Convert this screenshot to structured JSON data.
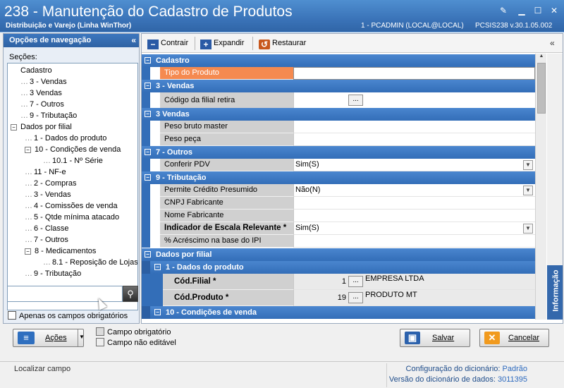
{
  "window": {
    "title": "238 - Manutenção do Cadastro de Produtos",
    "subtitle": "Distribuição e Varejo (Linha WinThor)",
    "session": "1 - PCADMIN (LOCAL@LOCAL)",
    "module": "PCSIS238  v.30.1.05.002"
  },
  "nav": {
    "header": "Opções de navegação",
    "sections_label": "Seções:",
    "items": [
      {
        "label": "Cadastro"
      },
      {
        "label": "3 - Vendas"
      },
      {
        "label": "3 Vendas"
      },
      {
        "label": "7 - Outros"
      },
      {
        "label": "9 - Tributação"
      },
      {
        "label": "Dados por filial"
      },
      {
        "label": "1 - Dados do produto"
      },
      {
        "label": "10 - Condições de venda"
      },
      {
        "label": "10.1 - Nº Série"
      },
      {
        "label": "11 - NF-e"
      },
      {
        "label": "2 - Compras"
      },
      {
        "label": "3 - Vendas"
      },
      {
        "label": "4 - Comissões de venda"
      },
      {
        "label": "5 - Qtde mínima atacado"
      },
      {
        "label": "6 - Classe"
      },
      {
        "label": "7 - Outros"
      },
      {
        "label": "8 - Medicamentos"
      },
      {
        "label": "8.1 -  Reposição de Lojas"
      },
      {
        "label": "9 - Tributação"
      }
    ],
    "search_value": "",
    "required_only_label": "Apenas os campos obrigatórios"
  },
  "toolbar": {
    "collapse": "Contrair",
    "expand": "Expandir",
    "restore": "Restaurar"
  },
  "grid": {
    "cadastro": {
      "title": "Cadastro",
      "tipo_produto": "Tipo do Produto",
      "tipo_produto_value": ""
    },
    "vendas1": {
      "title": "3 - Vendas",
      "codigo_filial_retira": "Código da filial retira",
      "codigo_filial_retira_value": ""
    },
    "vendas2": {
      "title": "3 Vendas",
      "peso_bruto": "Peso bruto master",
      "peso_bruto_value": "",
      "peso_peca": "Peso peça",
      "peso_peca_value": ""
    },
    "outros": {
      "title": "7 - Outros",
      "conferir_pdv": "Conferir PDV",
      "conferir_pdv_value": "Sim(S)"
    },
    "tributacao": {
      "title": "9 - Tributação",
      "credito_presumido": "Permite Crédito Presumido",
      "credito_presumido_value": "Não(N)",
      "cnpj_fabricante": "CNPJ Fabricante",
      "cnpj_fabricante_value": "",
      "nome_fabricante": "Nome Fabricante",
      "nome_fabricante_value": "",
      "escala_relevante": "Indicador de Escala Relevante *",
      "escala_relevante_value": "Sim(S)",
      "acrescimo_ipi": "% Acréscimo na base do IPI",
      "acrescimo_ipi_value": ""
    },
    "dados_filial": {
      "title": "Dados por filial",
      "dados_produto": {
        "title": "1 - Dados do produto",
        "cod_filial": "Cód.Filial *",
        "cod_filial_value": "1",
        "cod_filial_desc": "EMPRESA LTDA",
        "cod_produto": "Cód.Produto *",
        "cod_produto_value": "19",
        "cod_produto_desc": "PRODUTO MT"
      },
      "condicoes_venda": {
        "title": "10 - Condições de venda"
      }
    },
    "ellipsis": "..."
  },
  "info_tab": "Informação",
  "bottom": {
    "actions": "Ações",
    "legend_required": "Campo obrigatório",
    "legend_not_editable": "Campo não editável",
    "save": "Salvar",
    "cancel": "Cancelar"
  },
  "status": {
    "hint": "Localizar campo",
    "dict_config_label": "Configuração do dicionário:",
    "dict_config_value": "Padrão",
    "dict_version_label": "Versão do dicionário de dados:",
    "dict_version_value": "3011395"
  },
  "colors": {
    "title_bar": "#3a73b8",
    "category_row": "#336eb8",
    "selected_property": "#f58a50",
    "property_name_bg": "#d0d0d0"
  }
}
